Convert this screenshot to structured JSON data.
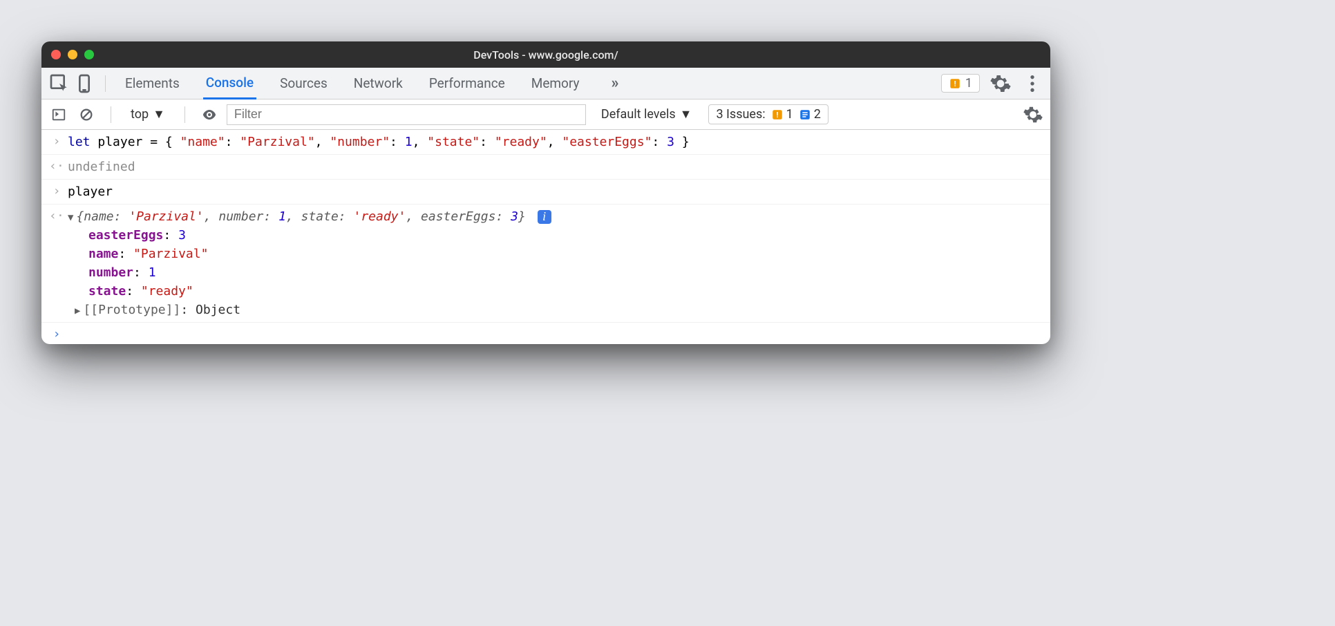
{
  "window_title": "DevTools - www.google.com/",
  "tabs": {
    "items": [
      "Elements",
      "Console",
      "Sources",
      "Network",
      "Performance",
      "Memory"
    ],
    "active_index": 1
  },
  "warning_count": "1",
  "toolbar": {
    "context": "top",
    "filter_placeholder": "Filter",
    "levels": "Default levels",
    "issues_label": "3 Issues:",
    "issues_warn": "1",
    "issues_info": "2"
  },
  "console": {
    "input1_keyword": "let",
    "input1_plain": " player = { ",
    "input1_k1": "\"name\"",
    "input1_v1": "\"Parzival\"",
    "input1_k2": "\"number\"",
    "input1_v2": "1",
    "input1_k3": "\"state\"",
    "input1_v3": "\"ready\"",
    "input1_k4": "\"easterEggs\"",
    "input1_v4": "3",
    "undefined": "undefined",
    "input2": "player",
    "summary_name_k": "name:",
    "summary_name_v": "'Parzival'",
    "summary_number_k": "number:",
    "summary_number_v": "1",
    "summary_state_k": "state:",
    "summary_state_v": "'ready'",
    "summary_eggs_k": "easterEggs:",
    "summary_eggs_v": "3",
    "prop_eggs_k": "easterEggs",
    "prop_eggs_v": "3",
    "prop_name_k": "name",
    "prop_name_v": "\"Parzival\"",
    "prop_number_k": "number",
    "prop_number_v": "1",
    "prop_state_k": "state",
    "prop_state_v": "\"ready\"",
    "proto_label": "[[Prototype]]",
    "proto_value": "Object"
  }
}
